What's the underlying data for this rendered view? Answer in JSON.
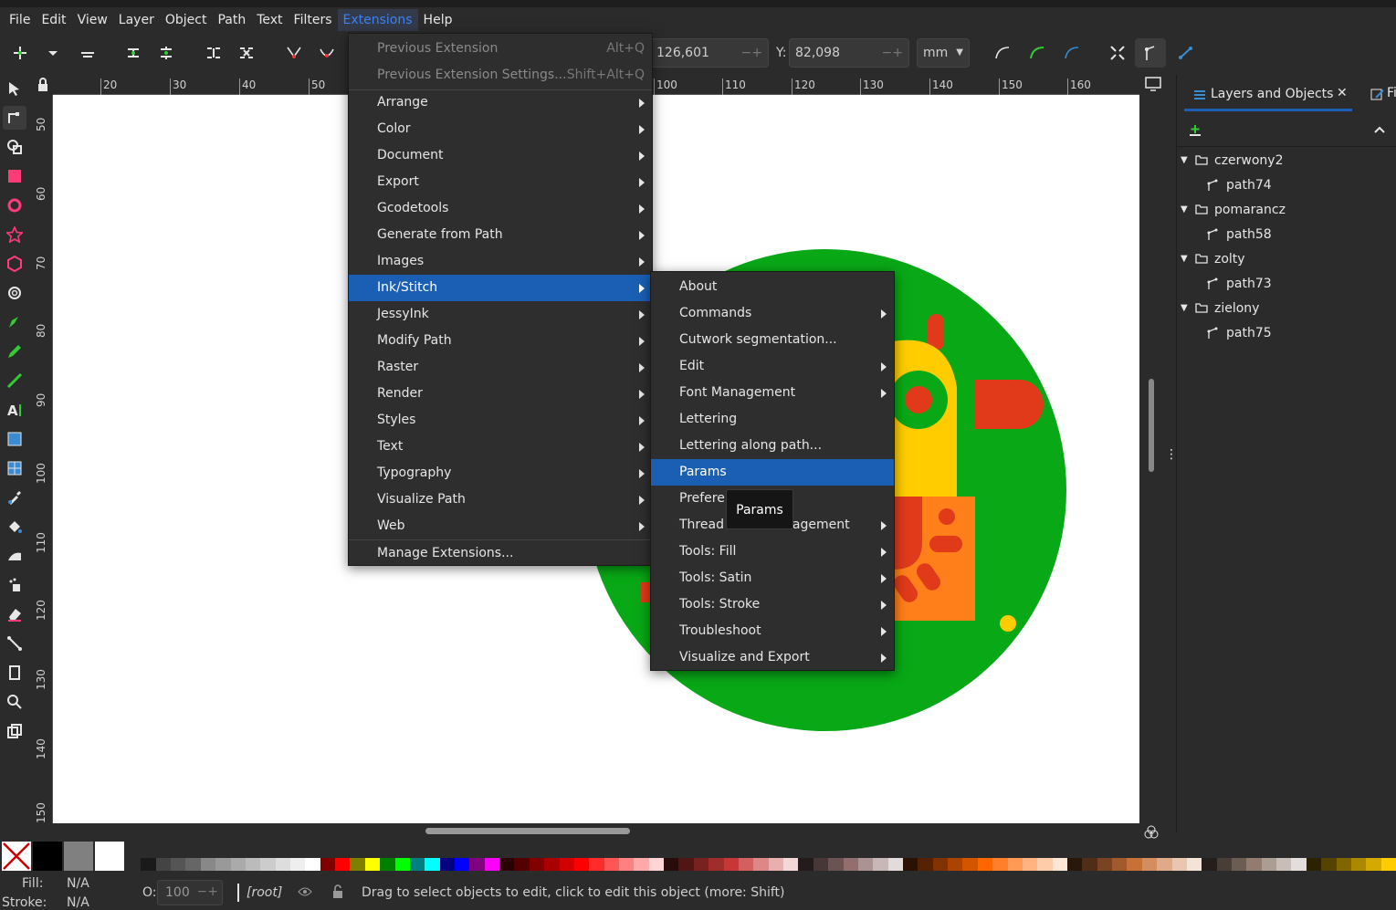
{
  "menubar": {
    "items": [
      "File",
      "Edit",
      "View",
      "Layer",
      "Object",
      "Path",
      "Text",
      "Filters",
      "Extensions",
      "Help"
    ]
  },
  "toolbar": {
    "x_value": "126,601",
    "y_label": "Y:",
    "y_value": "82,098",
    "unit": "mm"
  },
  "ruler": {
    "h_ticks": [
      "20",
      "30",
      "40",
      "50",
      "100",
      "110",
      "120",
      "130",
      "140",
      "150",
      "160"
    ],
    "v_ticks": [
      "50",
      "60",
      "70",
      "80",
      "90",
      "100",
      "110",
      "120",
      "130",
      "140",
      "150"
    ]
  },
  "extensions_menu": {
    "items": [
      {
        "label": "Previous Extension",
        "accel": "Alt+Q",
        "disabled": true
      },
      {
        "label": "Previous Extension Settings...",
        "accel": "Shift+Alt+Q",
        "disabled": true
      },
      {
        "label": "Arrange",
        "submenu": true
      },
      {
        "label": "Color",
        "submenu": true
      },
      {
        "label": "Document",
        "submenu": true
      },
      {
        "label": "Export",
        "submenu": true
      },
      {
        "label": "Gcodetools",
        "submenu": true
      },
      {
        "label": "Generate from Path",
        "submenu": true
      },
      {
        "label": "Images",
        "submenu": true
      },
      {
        "label": "Ink/Stitch",
        "submenu": true,
        "highlighted": true
      },
      {
        "label": "JessyInk",
        "submenu": true
      },
      {
        "label": "Modify Path",
        "submenu": true
      },
      {
        "label": "Raster",
        "submenu": true
      },
      {
        "label": "Render",
        "submenu": true
      },
      {
        "label": "Styles",
        "submenu": true
      },
      {
        "label": "Text",
        "submenu": true
      },
      {
        "label": "Typography",
        "submenu": true
      },
      {
        "label": "Visualize Path",
        "submenu": true
      },
      {
        "label": "Web",
        "submenu": true
      },
      {
        "label": "Manage Extensions...",
        "submenu": false
      }
    ]
  },
  "inkstitch_menu": {
    "items": [
      {
        "label": "About",
        "submenu": false
      },
      {
        "label": "Commands",
        "submenu": true
      },
      {
        "label": "Cutwork segmentation...",
        "submenu": false
      },
      {
        "label": "Edit",
        "submenu": true
      },
      {
        "label": "Font Management",
        "submenu": true
      },
      {
        "label": "Lettering",
        "submenu": false
      },
      {
        "label": "Lettering along path...",
        "submenu": false
      },
      {
        "label": "Params",
        "submenu": false,
        "highlighted": true
      },
      {
        "label": "Preferences",
        "submenu": false
      },
      {
        "label": "Thread Color Management",
        "submenu": true
      },
      {
        "label": "Tools: Fill",
        "submenu": true
      },
      {
        "label": "Tools: Satin",
        "submenu": true
      },
      {
        "label": "Tools: Stroke",
        "submenu": true
      },
      {
        "label": "Troubleshoot",
        "submenu": true
      },
      {
        "label": "Visualize and Export",
        "submenu": true
      }
    ]
  },
  "tooltip": "Params",
  "panel": {
    "tab_label": "Layers and Objects",
    "tab2_label": "Fi",
    "layers": [
      {
        "name": "czerwony2",
        "child": "path74"
      },
      {
        "name": "pomarancz",
        "child": "path58"
      },
      {
        "name": "zolty",
        "child": "path73"
      },
      {
        "name": "zielony",
        "child": "path75"
      }
    ]
  },
  "palette": {
    "colors": [
      "#2b2b2b",
      "#1a1a1a",
      "#444444",
      "#555555",
      "#666666",
      "#888888",
      "#999999",
      "#aaaaaa",
      "#bbbbbb",
      "#cccccc",
      "#dddddd",
      "#eeeeee",
      "#ffffff",
      "#800000",
      "#ff0000",
      "#808000",
      "#ffff00",
      "#008000",
      "#00ff00",
      "#008080",
      "#00ffff",
      "#000080",
      "#0000ff",
      "#800080",
      "#ff00ff",
      "#2b0000",
      "#550000",
      "#800000",
      "#aa0000",
      "#d40000",
      "#ff0000",
      "#ff2a2a",
      "#ff5555",
      "#ff8080",
      "#ffaaaa",
      "#ffd5d5",
      "#280b0b",
      "#501616",
      "#782121",
      "#a02c2c",
      "#c83737",
      "#d35f5f",
      "#de8787",
      "#e9afaf",
      "#f4d7d7",
      "#241c1c",
      "#483737",
      "#6c5353",
      "#916f6f",
      "#ac9393",
      "#c8b7b7",
      "#e3dbdb",
      "#2b1100",
      "#552200",
      "#803300",
      "#aa4400",
      "#d45500",
      "#ff6600",
      "#ff7f2a",
      "#ff9955",
      "#ffb380",
      "#ffccaa",
      "#ffe6d5",
      "#28170b",
      "#502d16",
      "#784421",
      "#a05a2c",
      "#c87137",
      "#d38d5f",
      "#deaa87",
      "#e9c6af",
      "#f4e3d7",
      "#241f1c",
      "#483e37",
      "#6c5d53",
      "#917c6f",
      "#ac9d93",
      "#c8beb7",
      "#e3dedb",
      "#2b2200",
      "#554400",
      "#806600",
      "#aa8800",
      "#d4aa00",
      "#ffcc00"
    ]
  },
  "status": {
    "fill_label": "Fill:",
    "fill_value": "N/A",
    "stroke_label": "Stroke:",
    "stroke_value": "N/A",
    "opacity_label": "O:",
    "opacity_value": "100",
    "layer": "[root]",
    "message": "Drag to select objects to edit, click to edit this object (more: Shift)"
  }
}
